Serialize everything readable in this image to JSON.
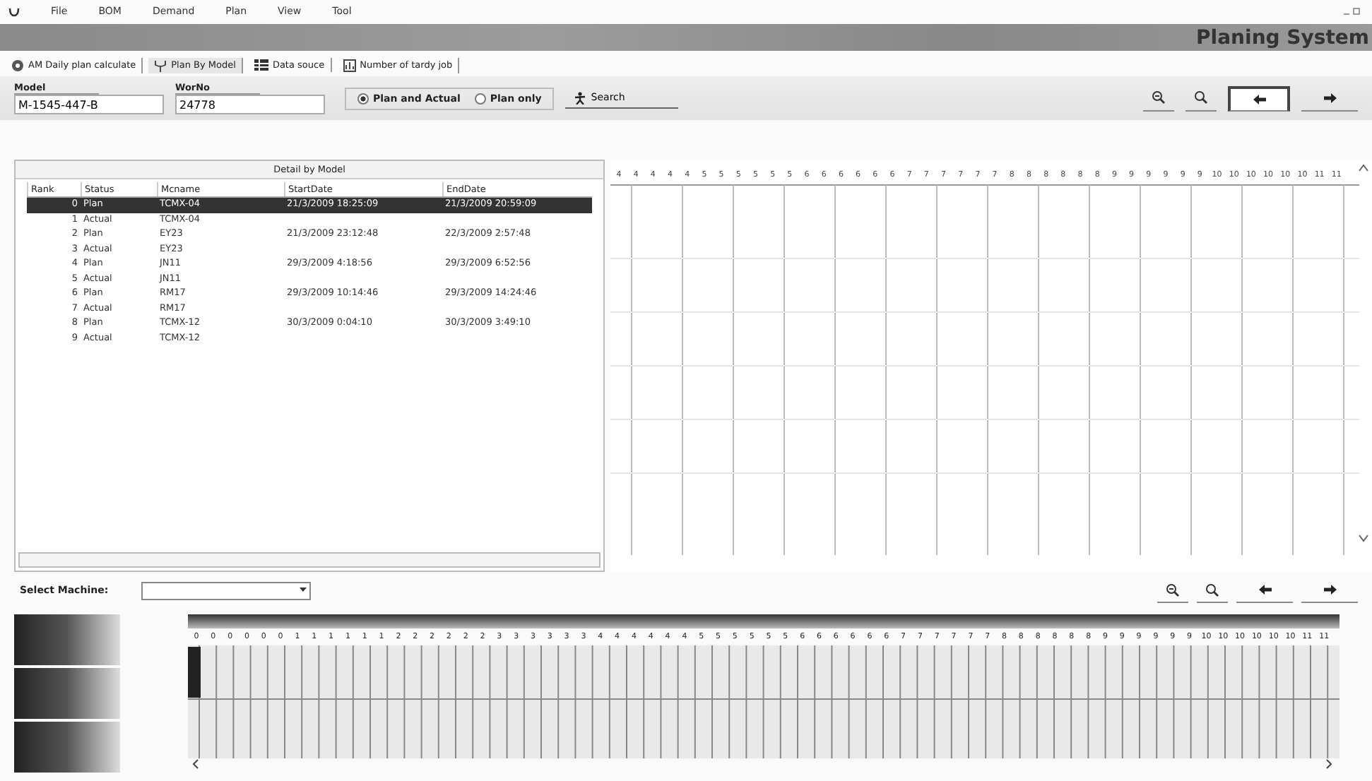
{
  "menu": [
    "File",
    "BOM",
    "Demand",
    "Plan",
    "View",
    "Tool"
  ],
  "banner": {
    "title": "Planing System"
  },
  "tabs": [
    {
      "label": "AM Daily plan calculate",
      "kind": "gear",
      "selected": false
    },
    {
      "label": "Plan By Model",
      "kind": "fork",
      "selected": true
    },
    {
      "label": "Data souce",
      "kind": "grid",
      "selected": false
    },
    {
      "label": "Number of tardy job",
      "kind": "chart",
      "selected": false
    }
  ],
  "fields": [
    {
      "label": "Model",
      "value": "M-1545-447-B"
    },
    {
      "label": "WorNo",
      "value": "24778"
    }
  ],
  "view_options": [
    {
      "label": "Plan and Actual",
      "selected": true
    },
    {
      "label": "Plan only",
      "selected": false
    }
  ],
  "search_button": "Search",
  "detail": {
    "title": "Detail by Model",
    "columns": [
      "Rank",
      "Status",
      "Mcname",
      "StartDate",
      "EndDate"
    ],
    "rows": [
      {
        "cells": [
          "0",
          "Plan",
          "TCMX-04",
          "21/3/2009 18:25:09",
          "21/3/2009 20:59:09"
        ],
        "selected": true
      },
      {
        "cells": [
          "1",
          "Actual",
          "TCMX-04",
          "",
          ""
        ],
        "selected": false
      },
      {
        "cells": [
          "2",
          "Plan",
          "EY23",
          "21/3/2009 23:12:48",
          "22/3/2009 2:57:48"
        ],
        "selected": false
      },
      {
        "cells": [
          "3",
          "Actual",
          "EY23",
          "",
          ""
        ],
        "selected": false
      },
      {
        "cells": [
          "4",
          "Plan",
          "JN11",
          "29/3/2009 4:18:56",
          "29/3/2009 6:52:56"
        ],
        "selected": false
      },
      {
        "cells": [
          "5",
          "Actual",
          "JN11",
          "",
          ""
        ],
        "selected": false
      },
      {
        "cells": [
          "6",
          "Plan",
          "RM17",
          "29/3/2009 10:14:46",
          "29/3/2009 14:24:46"
        ],
        "selected": false
      },
      {
        "cells": [
          "7",
          "Actual",
          "RM17",
          "",
          ""
        ],
        "selected": false
      },
      {
        "cells": [
          "8",
          "Plan",
          "TCMX-12",
          "30/3/2009 0:04:10",
          "30/3/2009 3:49:10"
        ],
        "selected": false
      },
      {
        "cells": [
          "9",
          "Actual",
          "TCMX-12",
          "",
          ""
        ],
        "selected": false
      }
    ]
  },
  "model_chart": {
    "ticks": [
      "4",
      "4",
      "4",
      "4",
      "4",
      "5",
      "5",
      "5",
      "5",
      "5",
      "5",
      "6",
      "6",
      "6",
      "6",
      "6",
      "6",
      "7",
      "7",
      "7",
      "7",
      "7",
      "7",
      "8",
      "8",
      "8",
      "8",
      "8",
      "8",
      "9",
      "9",
      "9",
      "9",
      "9",
      "9",
      "10",
      "10",
      "10",
      "10",
      "10",
      "10",
      "11",
      "11"
    ]
  },
  "machine": {
    "label": "Select Machine:"
  },
  "machine_chart": {
    "ticks": [
      "0",
      "0",
      "0",
      "0",
      "0",
      "0",
      "1",
      "1",
      "1",
      "1",
      "1",
      "1",
      "2",
      "2",
      "2",
      "2",
      "2",
      "2",
      "3",
      "3",
      "3",
      "3",
      "3",
      "3",
      "4",
      "4",
      "4",
      "4",
      "4",
      "4",
      "5",
      "5",
      "5",
      "5",
      "5",
      "5",
      "6",
      "6",
      "6",
      "6",
      "6",
      "6",
      "7",
      "7",
      "7",
      "7",
      "7",
      "7",
      "8",
      "8",
      "8",
      "8",
      "8",
      "8",
      "9",
      "9",
      "9",
      "9",
      "9",
      "9",
      "10",
      "10",
      "10",
      "10",
      "10",
      "10",
      "11",
      "11"
    ]
  }
}
